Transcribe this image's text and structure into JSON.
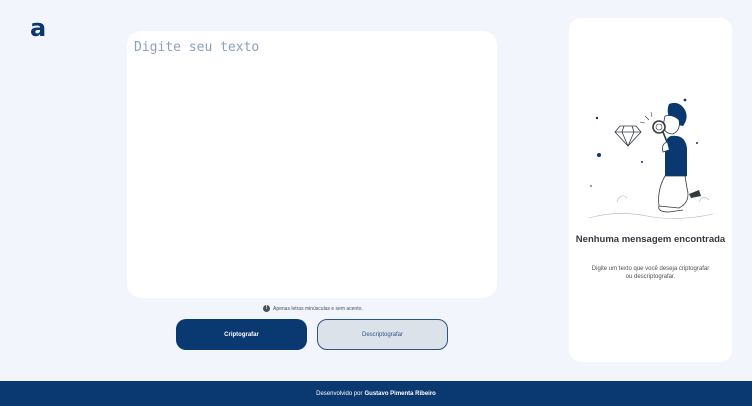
{
  "header": {
    "logo_text": "a"
  },
  "editor": {
    "placeholder": "Digite seu texto"
  },
  "hint": {
    "icon": "info-icon",
    "icon_glyph": "!",
    "text": "Apenas letras minúsculas e sem acento."
  },
  "buttons": {
    "encrypt_label": "Criptografar",
    "decrypt_label": "Descriptografar"
  },
  "output": {
    "title": "Nenhuma mensagem encontrada",
    "description": "Digite um texto que você deseja criptografar ou descriptografar.",
    "illustration": "boy-with-magnifier-illustration"
  },
  "footer": {
    "prefix": "Desenvolvido por",
    "author": "Gustavo Pimenta Ribeiro"
  },
  "colors": {
    "background": "#f3f5fc",
    "primary": "#0a3871",
    "panel": "#ffffff"
  }
}
